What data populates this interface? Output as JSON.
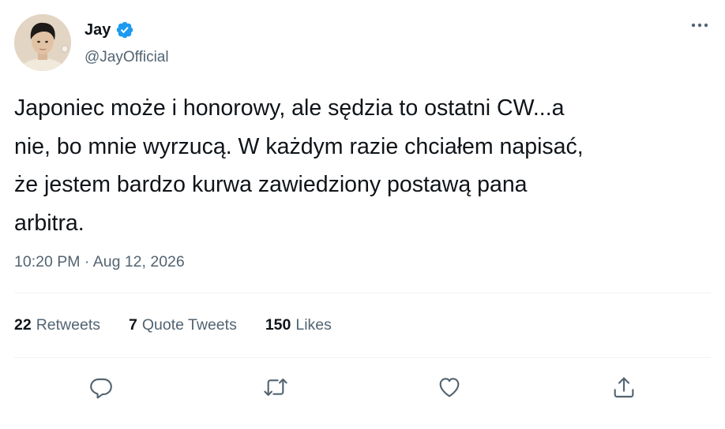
{
  "author": {
    "display_name": "Jay",
    "handle": "@JayOfficial",
    "verified": true,
    "avatar_icon": "avatar-photo"
  },
  "menu": {
    "icon": "more-dots-icon"
  },
  "tweet": {
    "text": "Japoniec może i honorowy, ale sędzia to ostatni CW...a\nnie, bo mnie wyrzucą. W każdym razie chciałem napisać,\nże jestem bardzo kurwa zawiedziony postawą pana\narbitra.",
    "timestamp": "10:20 PM · Aug 12, 2026"
  },
  "stats": {
    "retweets": {
      "count": "22",
      "label": "Retweets"
    },
    "quotes": {
      "count": "7",
      "label": "Quote Tweets"
    },
    "likes": {
      "count": "150",
      "label": "Likes"
    }
  },
  "actions": [
    "reply-icon",
    "retweet-icon",
    "like-icon",
    "share-icon"
  ],
  "colors": {
    "text": "#0f1419",
    "secondary": "#536471",
    "verified": "#1d9bf0",
    "divider": "#eff3f4"
  }
}
